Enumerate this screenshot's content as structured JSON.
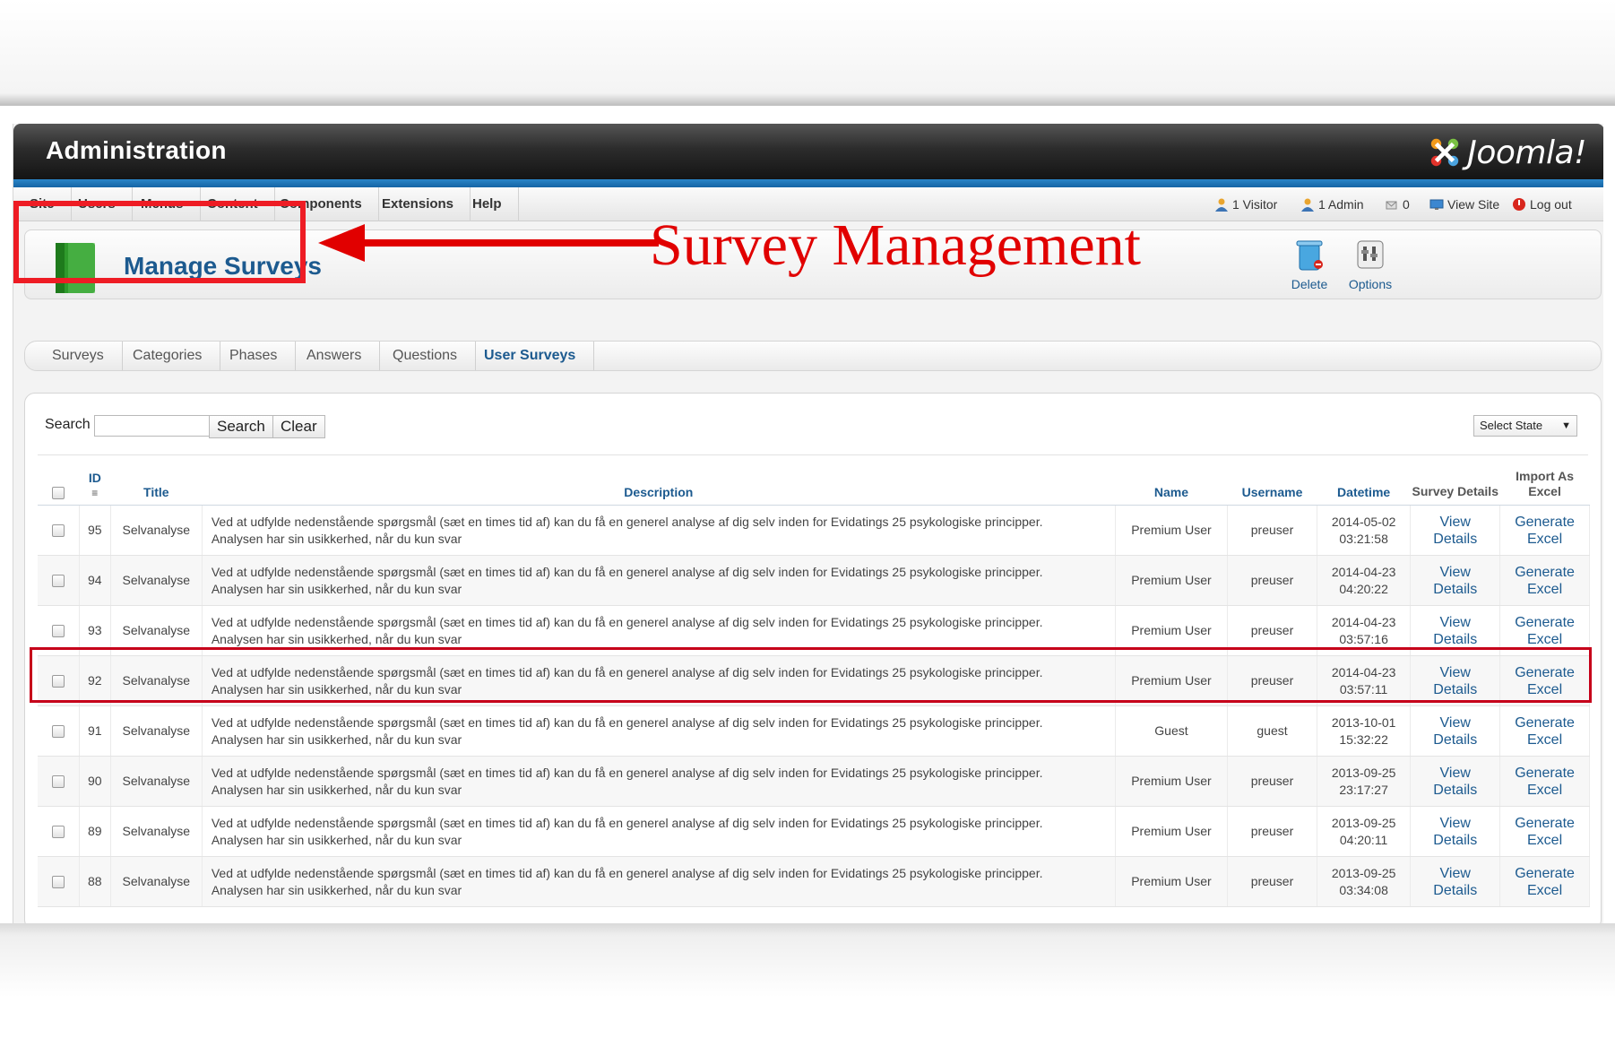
{
  "header": {
    "title": "Administration",
    "logo_text": "Joomla!"
  },
  "menu": {
    "items": [
      "Site",
      "Users",
      "Menus",
      "Content",
      "Components",
      "Extensions",
      "Help"
    ]
  },
  "status": {
    "visitors": "1 Visitor",
    "admins": "1 Admin",
    "messages": "0",
    "view_site": "View Site",
    "logout": "Log out"
  },
  "page": {
    "title": "Manage Surveys",
    "annotation": "Survey Management"
  },
  "toolbar": {
    "delete_label": "Delete",
    "options_label": "Options"
  },
  "tabs": [
    "Surveys",
    "Categories",
    "Phases",
    "Answers",
    "Questions",
    "User Surveys"
  ],
  "search": {
    "label": "Search",
    "value": "",
    "search_button": "Search",
    "clear_button": "Clear",
    "state_select": "Select State"
  },
  "table": {
    "headers": {
      "id": "ID",
      "title": "Title",
      "description": "Description",
      "name": "Name",
      "username": "Username",
      "datetime": "Datetime",
      "survey_details": "Survey Details",
      "import_excel": "Import As Excel"
    },
    "rows": [
      {
        "id": "95",
        "title": "Selvanalyse",
        "desc1": "Ved at udfylde nedenstående spørgsmål (sæt en times tid af) kan du få en generel analyse af dig selv inden for Evidatings 25 psykologiske principper.",
        "desc2": "Analysen har sin usikkerhed, når du kun svar",
        "name": "Premium User",
        "username": "preuser",
        "date": "2014-05-02",
        "time": "03:21:58",
        "view1": "View",
        "view2": "Details",
        "gen1": "Generate",
        "gen2": "Excel"
      },
      {
        "id": "94",
        "title": "Selvanalyse",
        "desc1": "Ved at udfylde nedenstående spørgsmål (sæt en times tid af) kan du få en generel analyse af dig selv inden for Evidatings 25 psykologiske principper.",
        "desc2": "Analysen har sin usikkerhed, når du kun svar",
        "name": "Premium User",
        "username": "preuser",
        "date": "2014-04-23",
        "time": "04:20:22",
        "view1": "View",
        "view2": "Details",
        "gen1": "Generate",
        "gen2": "Excel"
      },
      {
        "id": "93",
        "title": "Selvanalyse",
        "desc1": "Ved at udfylde nedenstående spørgsmål (sæt en times tid af) kan du få en generel analyse af dig selv inden for Evidatings 25 psykologiske principper.",
        "desc2": "Analysen har sin usikkerhed, når du kun svar",
        "name": "Premium User",
        "username": "preuser",
        "date": "2014-04-23",
        "time": "03:57:16",
        "view1": "View",
        "view2": "Details",
        "gen1": "Generate",
        "gen2": "Excel"
      },
      {
        "id": "92",
        "title": "Selvanalyse",
        "desc1": "Ved at udfylde nedenstående spørgsmål (sæt en times tid af) kan du få en generel analyse af dig selv inden for Evidatings 25 psykologiske principper.",
        "desc2": "Analysen har sin usikkerhed, når du kun svar",
        "name": "Premium User",
        "username": "preuser",
        "date": "2014-04-23",
        "time": "03:57:11",
        "view1": "View",
        "view2": "Details",
        "gen1": "Generate",
        "gen2": "Excel"
      },
      {
        "id": "91",
        "title": "Selvanalyse",
        "desc1": "Ved at udfylde nedenstående spørgsmål (sæt en times tid af) kan du få en generel analyse af dig selv inden for Evidatings 25 psykologiske principper.",
        "desc2": "Analysen har sin usikkerhed, når du kun svar",
        "name": "Guest",
        "username": "guest",
        "date": "2013-10-01",
        "time": "15:32:22",
        "view1": "View",
        "view2": "Details",
        "gen1": "Generate",
        "gen2": "Excel"
      },
      {
        "id": "90",
        "title": "Selvanalyse",
        "desc1": "Ved at udfylde nedenstående spørgsmål (sæt en times tid af) kan du få en generel analyse af dig selv inden for Evidatings 25 psykologiske principper.",
        "desc2": "Analysen har sin usikkerhed, når du kun svar",
        "name": "Premium User",
        "username": "preuser",
        "date": "2013-09-25",
        "time": "23:17:27",
        "view1": "View",
        "view2": "Details",
        "gen1": "Generate",
        "gen2": "Excel"
      },
      {
        "id": "89",
        "title": "Selvanalyse",
        "desc1": "Ved at udfylde nedenstående spørgsmål (sæt en times tid af) kan du få en generel analyse af dig selv inden for Evidatings 25 psykologiske principper.",
        "desc2": "Analysen har sin usikkerhed, når du kun svar",
        "name": "Premium User",
        "username": "preuser",
        "date": "2013-09-25",
        "time": "04:20:11",
        "view1": "View",
        "view2": "Details",
        "gen1": "Generate",
        "gen2": "Excel"
      },
      {
        "id": "88",
        "title": "Selvanalyse",
        "desc1": "Ved at udfylde nedenstående spørgsmål (sæt en times tid af) kan du få en generel analyse af dig selv inden for Evidatings 25 psykologiske principper.",
        "desc2": "Analysen har sin usikkerhed, når du kun svar",
        "name": "Premium User",
        "username": "preuser",
        "date": "2013-09-25",
        "time": "03:34:08",
        "view1": "View",
        "view2": "Details",
        "gen1": "Generate",
        "gen2": "Excel"
      }
    ]
  },
  "icons": {
    "logo": "joomla-logo-icon",
    "page": "green-book-icon",
    "delete": "trash-icon",
    "options": "options-icon",
    "visitor": "user-icon",
    "admin": "admin-icon",
    "messages": "mail-icon",
    "view_site": "monitor-icon",
    "logout": "power-icon"
  },
  "colors": {
    "accent_blue": "#1c5a8f",
    "annotation_red": "#e10000",
    "highlight_red": "#c6001a",
    "header_dark": "#1a1a1a",
    "strip_blue": "#1f74b8"
  }
}
